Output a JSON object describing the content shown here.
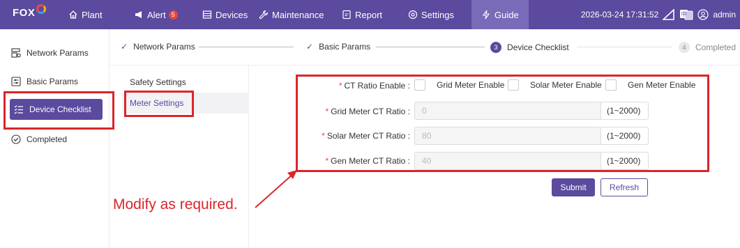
{
  "header": {
    "logo_text": "FOX",
    "nav": [
      {
        "label": "Plant",
        "icon": "home-icon"
      },
      {
        "label": "Alert",
        "icon": "megaphone-icon",
        "badge": "5"
      },
      {
        "label": "Devices",
        "icon": "list-icon"
      },
      {
        "label": "Maintenance",
        "icon": "wrench-icon"
      },
      {
        "label": "Report",
        "icon": "document-icon"
      },
      {
        "label": "Settings",
        "icon": "gear-icon"
      },
      {
        "label": "Guide",
        "icon": "bolt-icon"
      }
    ],
    "datetime": "2026-03-24 17:31:52",
    "user": "admin"
  },
  "sidebar": {
    "items": [
      {
        "label": "Network Params",
        "icon": "network-icon"
      },
      {
        "label": "Basic Params",
        "icon": "settings-panel-icon"
      },
      {
        "label": "Device Checklist",
        "icon": "checklist-icon"
      },
      {
        "label": "Completed",
        "icon": "check-circle-icon"
      }
    ]
  },
  "steps": [
    {
      "label": "Network Params",
      "state": "done"
    },
    {
      "label": "Basic Params",
      "state": "done"
    },
    {
      "label": "Device Checklist",
      "state": "active",
      "num": "3"
    },
    {
      "label": "Completed",
      "state": "pending",
      "num": "4"
    }
  ],
  "submenu": {
    "items": [
      {
        "label": "Safety Settings"
      },
      {
        "label": "Meter Settings"
      }
    ]
  },
  "form": {
    "ct_ratio_enable": {
      "label": "CT Ratio Enable :",
      "options": [
        "Grid Meter Enable",
        "Solar Meter Enable",
        "Gen Meter Enable"
      ]
    },
    "grid_ct": {
      "label": "Grid Meter CT Ratio :",
      "value": "0",
      "range": "(1~2000)"
    },
    "solar_ct": {
      "label": "Solar Meter CT Ratio :",
      "value": "80",
      "range": "(1~2000)"
    },
    "gen_ct": {
      "label": "Gen Meter CT Ratio :",
      "value": "40",
      "range": "(1~2000)"
    },
    "submit_label": "Submit",
    "refresh_label": "Refresh"
  },
  "annotation": {
    "note": "Modify as required.",
    "color": "#d9262a"
  },
  "colors": {
    "brand": "#5b4a9e",
    "required": "#e8443a"
  }
}
